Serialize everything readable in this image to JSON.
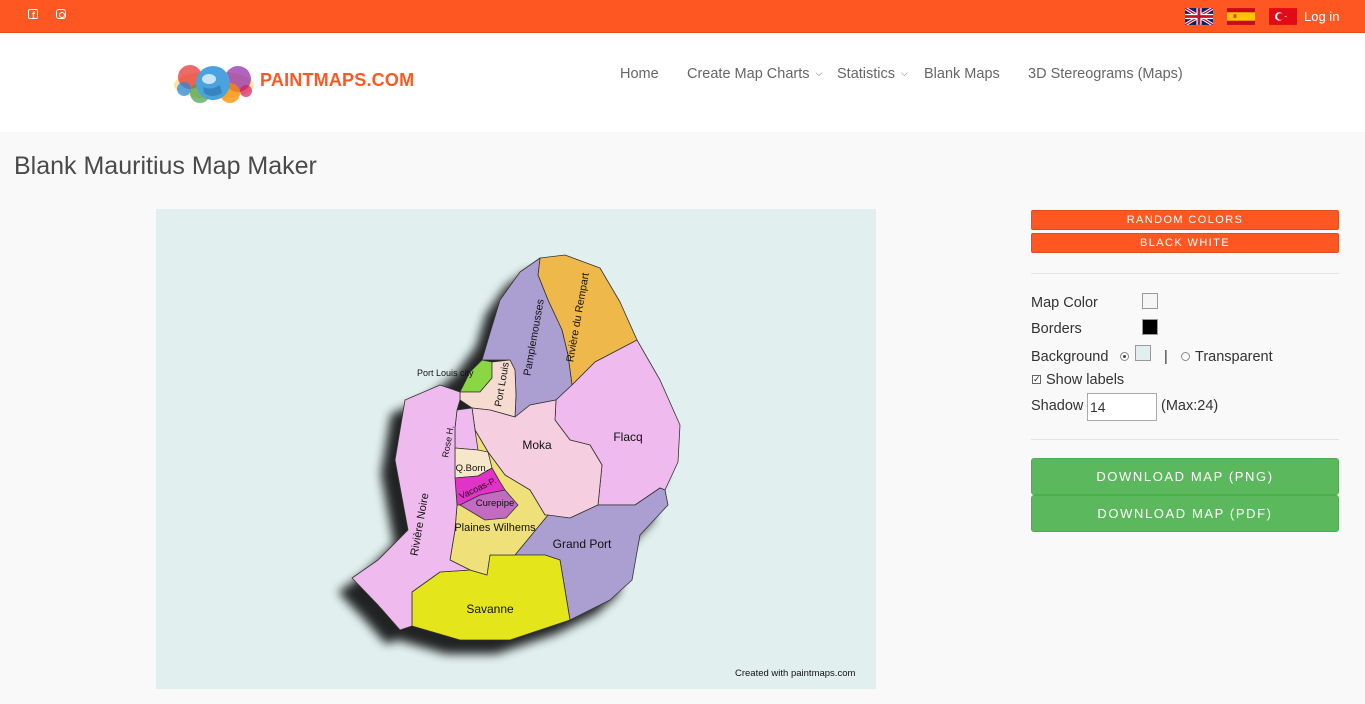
{
  "topbar": {
    "social_icons": [
      "facebook-icon",
      "instagram-icon"
    ],
    "flags": [
      "uk-flag",
      "spain-flag",
      "turkey-flag"
    ],
    "login_label": "Log in",
    "bg_color": "#ff5722"
  },
  "header": {
    "brand": "PAINTMAPS.COM",
    "nav": [
      {
        "label": "Home"
      },
      {
        "label": "Create Map Charts",
        "dropdown": true
      },
      {
        "label": "Statistics",
        "dropdown": true
      },
      {
        "label": "Blank Maps"
      },
      {
        "label": "3D Stereograms (Maps)"
      }
    ]
  },
  "page": {
    "title": "Blank Mauritius Map Maker"
  },
  "map": {
    "background_color": "#e1f0ef",
    "credit": "Created with paintmaps.com",
    "regions": {
      "riviere_du_rempart": "Rivière du Rempart",
      "pamplemousses": "Pamplemousses",
      "port_louis_city": "Port Louis city",
      "port_louis": "Port Louis",
      "flacq": "Flacq",
      "moka": "Moka",
      "rose_h": "Rose H.",
      "q_born": "Q.Born.",
      "vacoas": "Vacoas-P.",
      "curepipe": "Curepipe",
      "plaines_wilhems": "Plaines Wilhems",
      "riviere_noire": "Rivière Noire",
      "grand_port": "Grand Port",
      "savanne": "Savanne"
    },
    "region_colors": {
      "riviere_du_rempart": "#efb84a",
      "pamplemousses": "#ab9ed0",
      "port_louis_city": "#8bd643",
      "port_louis": "#f6dcd0",
      "flacq": "#efbaee",
      "moka": "#f5cfe0",
      "rose_h": "#efbaee",
      "q_born": "#f6e7ca",
      "vacoas": "#e233c9",
      "curepipe": "#c26bc0",
      "plaines_wilhems": "#efe07a",
      "riviere_noire": "#efbaee",
      "grand_port": "#ab9ed0",
      "savanne": "#e5e51c"
    }
  },
  "controls": {
    "random_colors": "RANDOM COLORS",
    "black_white": "BLACK WHITE",
    "map_color_label": "Map Color",
    "map_color": "#f5f5f5",
    "borders_label": "Borders",
    "borders_color": "#000000",
    "background_label": "Background",
    "background_color": "#e1f0ef",
    "separator": "|",
    "transparent_label": "Transparent",
    "show_labels_label": "Show labels",
    "show_labels_checked": true,
    "shadow_label": "Shadow",
    "shadow_value": "14",
    "shadow_max": "(Max:24)",
    "download_png": "DOWNLOAD MAP (PNG)",
    "download_pdf": "DOWNLOAD MAP (PDF)"
  }
}
